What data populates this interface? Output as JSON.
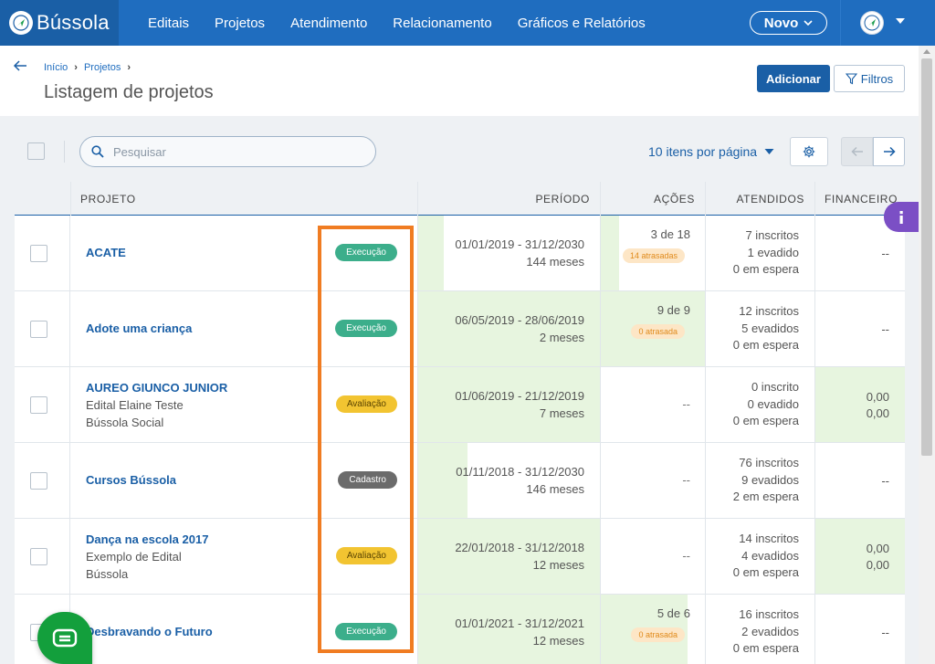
{
  "app": {
    "name": "Bússola"
  },
  "nav": {
    "items": [
      "Editais",
      "Projetos",
      "Atendimento",
      "Relacionamento",
      "Gráficos e Relatórios"
    ],
    "novo_label": "Novo"
  },
  "breadcrumb": {
    "items": [
      "Início",
      "Projetos"
    ]
  },
  "page": {
    "title": "Listagem de projetos"
  },
  "actions": {
    "add_label": "Adicionar",
    "filter_label": "Filtros"
  },
  "search": {
    "placeholder": "Pesquisar",
    "value": ""
  },
  "pagination": {
    "per_page_label": "10 itens por página"
  },
  "table": {
    "headers": {
      "projeto": "PROJETO",
      "periodo": "PERÍODO",
      "acoes": "AÇÕES",
      "atendidos": "ATENDIDOS",
      "financeiro": "FINANCEIRO"
    },
    "rows": [
      {
        "name": "ACATE",
        "sub1": "",
        "sub2": "",
        "status": "Execução",
        "status_type": "exec",
        "period": "01/01/2019 - 31/12/2030",
        "duration": "144 meses",
        "period_progress": 0.14,
        "acoes": "3 de 18",
        "acoes_progress": 0.17,
        "late": "14 atrasadas",
        "inscritos": "7 inscritos",
        "evadidos": "1 evadido",
        "espera": "0 em espera",
        "fin1": "--",
        "fin2": "",
        "fin_fill": false
      },
      {
        "name": "Adote uma criança",
        "sub1": "",
        "sub2": "",
        "status": "Execução",
        "status_type": "exec",
        "period": "06/05/2019 - 28/06/2019",
        "duration": "2 meses",
        "period_progress": 1.0,
        "acoes": "9 de 9",
        "acoes_progress": 1.0,
        "late": "0 atrasada",
        "inscritos": "12 inscritos",
        "evadidos": "5 evadidos",
        "espera": "0 em espera",
        "fin1": "--",
        "fin2": "",
        "fin_fill": false
      },
      {
        "name": "AUREO GIUNCO JUNIOR",
        "sub1": "Edital Elaine Teste",
        "sub2": "Bússola Social",
        "status": "Avaliação",
        "status_type": "aval",
        "period": "01/06/2019 - 21/12/2019",
        "duration": "7 meses",
        "period_progress": 1.0,
        "acoes": "--",
        "acoes_progress": 0,
        "late": "",
        "inscritos": "0 inscrito",
        "evadidos": "0 evadido",
        "espera": "0 em espera",
        "fin1": "0,00",
        "fin2": "0,00",
        "fin_fill": true
      },
      {
        "name": "Cursos Bússola",
        "sub1": "",
        "sub2": "",
        "status": "Cadastro",
        "status_type": "cad",
        "period": "01/11/2018 - 31/12/2030",
        "duration": "146 meses",
        "period_progress": 0.27,
        "acoes": "--",
        "acoes_progress": 0,
        "late": "",
        "inscritos": "76 inscritos",
        "evadidos": "9 evadidos",
        "espera": "2 em espera",
        "fin1": "--",
        "fin2": "",
        "fin_fill": false
      },
      {
        "name": "Dança na escola 2017",
        "sub1": "Exemplo de Edital",
        "sub2": "Bússola",
        "status": "Avaliação",
        "status_type": "aval",
        "period": "22/01/2018 - 31/12/2018",
        "duration": "12 meses",
        "period_progress": 1.0,
        "acoes": "--",
        "acoes_progress": 0,
        "late": "",
        "inscritos": "14 inscritos",
        "evadidos": "4 evadidos",
        "espera": "0 em espera",
        "fin1": "0,00",
        "fin2": "0,00",
        "fin_fill": true
      },
      {
        "name": "Desbravando o Futuro",
        "sub1": "",
        "sub2": "",
        "status": "Execução",
        "status_type": "exec",
        "period": "01/01/2021 - 31/12/2021",
        "duration": "12 meses",
        "period_progress": 1.0,
        "acoes": "5 de 6",
        "acoes_progress": 0.83,
        "late": "0 atrasada",
        "inscritos": "16 inscritos",
        "evadidos": "2 evadidos",
        "espera": "0 em espera",
        "fin1": "--",
        "fin2": "",
        "fin_fill": false
      }
    ]
  }
}
